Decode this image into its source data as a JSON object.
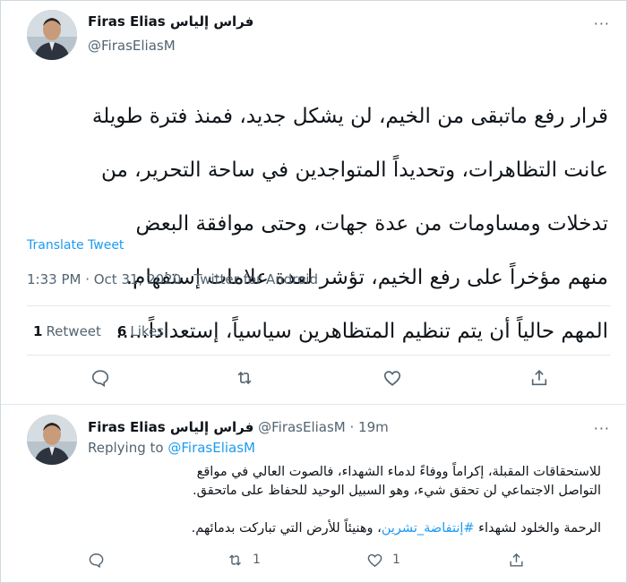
{
  "main_tweet": {
    "display_name": "Firas Elias فراس إلياس",
    "handle": "@FirasEliasM",
    "more_icon": "more-dots-icon",
    "text_lines": [
      "قرار رفع ماتبقى من الخيم، لن يشكل جديد، فمنذ فترة طويلة",
      "عانت التظاهرات، وتحديداً المتواجدين في ساحة التحرير، من",
      "تدخلات ومساومات من عدة جهات، وحتى موافقة البعض",
      "منهم مؤخراً على رفع الخيم، تؤشر لعدة علامات إستفهام.",
      "المهم حالياً أن يتم تنظيم المتظاهرين سياسياً، إستعداداً....."
    ],
    "translate_label": "Translate Tweet",
    "meta": "1:33 PM · Oct 31, 2020 · Twitter for Android",
    "retweets_count": "1",
    "retweets_label": "Retweet",
    "likes_count": "6",
    "likes_label": "Likes",
    "actions": [
      "reply-icon",
      "retweet-icon",
      "like-icon",
      "share-icon"
    ]
  },
  "reply_tweet": {
    "display_name": "Firas Elias فراس إلياس",
    "handle_time": "@FirasEliasM · 19m",
    "replying_to_label": "Replying to",
    "replying_to_handle": "@FirasEliasM",
    "paragraph1_line1": "للاستحقاقات المقبلة، إكراماً ووفاءً لدماء الشهداء، فالصوت العالي في مواقع",
    "paragraph1_line2": "التواصل الاجتماعي لن تحقق شيء، وهو السبيل الوحيد للحفاظ على ماتحقق.",
    "paragraph2_before": "الرحمة والخلود لشهداء ",
    "paragraph2_hashtag": "#إنتفاضة_تشرين",
    "paragraph2_after": "، وهنيئاً للأرض التي تباركت بدمائهم.",
    "retweet_count": "1",
    "like_count": "1"
  },
  "colors": {
    "link": "#1d9bf0",
    "secondary_text": "#536471",
    "primary_text": "#0f1419",
    "divider": "#e1e8ed"
  }
}
